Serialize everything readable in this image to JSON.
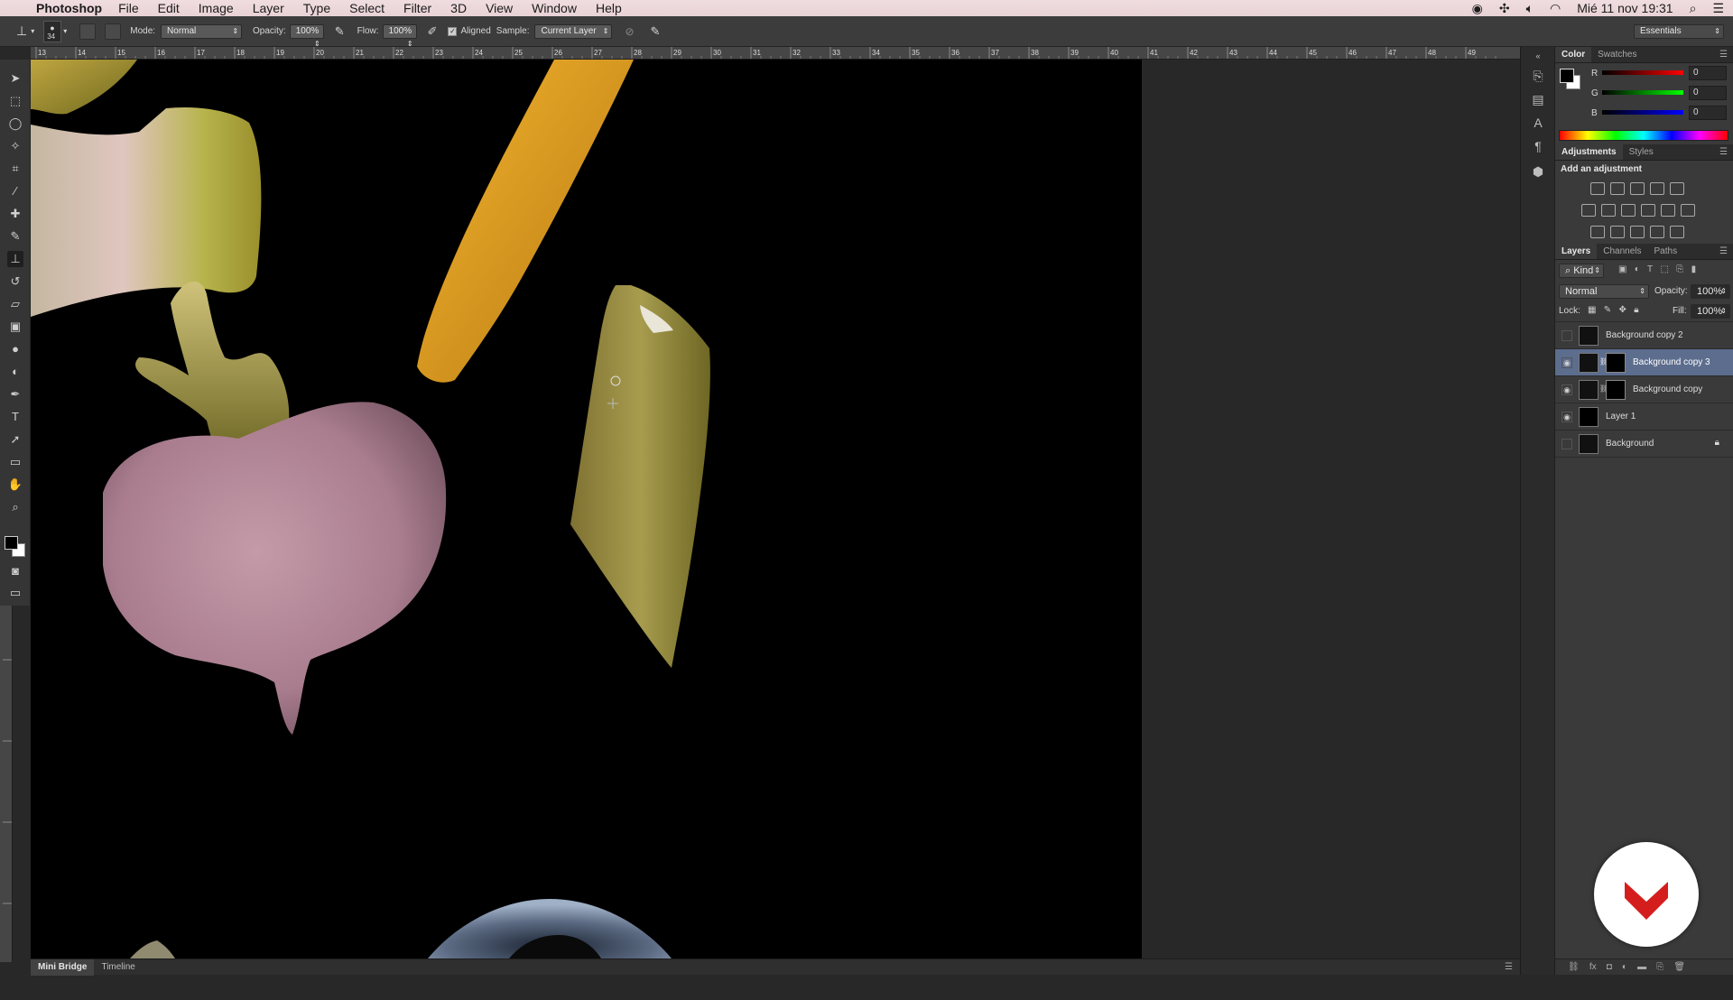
{
  "menubar": {
    "apple": "",
    "app_name": "Photoshop",
    "items": [
      "File",
      "Edit",
      "Image",
      "Layer",
      "Type",
      "Select",
      "Filter",
      "3D",
      "View",
      "Window",
      "Help"
    ],
    "clock": "Mié 11 nov  19:31"
  },
  "options_bar": {
    "brush_size": "34",
    "mode_label": "Mode:",
    "mode_value": "Normal",
    "opacity_label": "Opacity:",
    "opacity_value": "100%",
    "flow_label": "Flow:",
    "flow_value": "100%",
    "aligned_label": "Aligned",
    "sample_label": "Sample:",
    "sample_value": "Current Layer",
    "workspace": "Essentials"
  },
  "ruler": {
    "ticks": [
      "13",
      "14",
      "15",
      "16",
      "17",
      "18",
      "19",
      "20",
      "21",
      "22",
      "23",
      "24",
      "25",
      "26",
      "27",
      "28",
      "29",
      "30",
      "31",
      "32",
      "33",
      "34",
      "35",
      "36",
      "37",
      "38",
      "39",
      "40",
      "41",
      "42",
      "43",
      "44",
      "45",
      "46",
      "47",
      "48",
      "49"
    ]
  },
  "bottom_tabs": [
    "Mini Bridge",
    "Timeline"
  ],
  "color_panel": {
    "tabs": [
      "Color",
      "Swatches"
    ],
    "channels": [
      {
        "label": "R",
        "value": "0"
      },
      {
        "label": "G",
        "value": "0"
      },
      {
        "label": "B",
        "value": "0"
      }
    ]
  },
  "adjustments_panel": {
    "tabs": [
      "Adjustments",
      "Styles"
    ],
    "heading": "Add an adjustment"
  },
  "layers_panel": {
    "tabs": [
      "Layers",
      "Channels",
      "Paths"
    ],
    "filter_kind": "Kind",
    "blend_mode": "Normal",
    "opacity_label": "Opacity:",
    "opacity_value": "100%",
    "lock_label": "Lock:",
    "fill_label": "Fill:",
    "fill_value": "100%",
    "layers": [
      {
        "name": "Background copy 2",
        "visible": false,
        "mask": false,
        "active": false,
        "locked": false
      },
      {
        "name": "Background copy 3",
        "visible": true,
        "mask": true,
        "active": true,
        "locked": false
      },
      {
        "name": "Background copy",
        "visible": true,
        "mask": true,
        "active": false,
        "locked": false
      },
      {
        "name": "Layer 1",
        "visible": true,
        "mask": false,
        "active": false,
        "locked": false
      },
      {
        "name": "Background",
        "visible": false,
        "mask": false,
        "active": false,
        "locked": true
      }
    ]
  },
  "colors": {
    "accent": "#5c6d8e",
    "logo_red": "#d41e1e"
  }
}
